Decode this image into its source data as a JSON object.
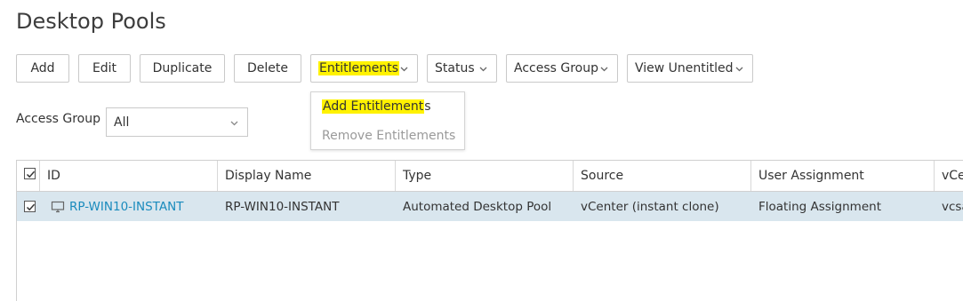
{
  "page": {
    "title": "Desktop Pools"
  },
  "toolbar": {
    "add": "Add",
    "edit": "Edit",
    "duplicate": "Duplicate",
    "delete": "Delete",
    "entitlements": "Entitlements",
    "status": "Status",
    "access_group": "Access Group",
    "view_unentitled": "View Unentitled"
  },
  "entitlements_menu": {
    "add_highlighted": "Add Entitlement",
    "add_rest": "s",
    "remove": "Remove Entitlements"
  },
  "filter": {
    "label": "Access Group",
    "value": "All"
  },
  "table": {
    "columns": [
      "ID",
      "Display Name",
      "Type",
      "Source",
      "User Assignment",
      "vCe"
    ],
    "rows": [
      {
        "id": "RP-WIN10-INSTANT",
        "display_name": "RP-WIN10-INSTANT",
        "type": "Automated Desktop Pool",
        "source": "vCenter (instant clone)",
        "user_assignment": "Floating Assignment",
        "vcenter": "vcsa"
      }
    ]
  },
  "colors": {
    "highlight": "#fff200",
    "link": "#1a8bbd",
    "selected_row": "#d9e6ee"
  },
  "icons": [
    "chevron-down-icon",
    "checkbox-checked-icon",
    "monitor-icon"
  ]
}
